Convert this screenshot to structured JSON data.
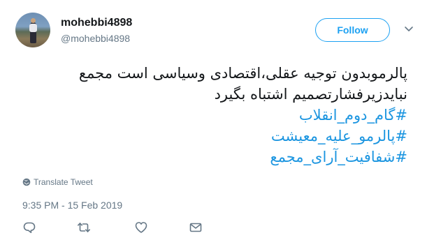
{
  "user": {
    "display_name": "mohebbi4898",
    "screen_name": "@mohebbi4898"
  },
  "follow_button": {
    "label": "Follow"
  },
  "tweet": {
    "lines": [
      "پالرموبدون توجیه عقلی،اقتصادی وسیاسی است مجمع",
      "نبایدزیرفشارتصمیم اشتباه بگیرد"
    ],
    "hashtags": [
      "#گام_دوم_انقلاب",
      "#پالرمو_علیه_معیشت",
      "#شفافیت_آرای_مجمع"
    ]
  },
  "translate_label": "Translate Tweet",
  "timestamp": "9:35 PM - 15 Feb 2019",
  "colors": {
    "accent": "#1da1f2",
    "hashtag": "#1b95e0",
    "muted": "#657786",
    "text": "#14171a"
  },
  "icons": {
    "reply": "reply-icon",
    "retweet": "retweet-icon",
    "like": "heart-icon",
    "dm": "envelope-icon",
    "caret": "chevron-down-icon",
    "translate": "globe-icon"
  }
}
